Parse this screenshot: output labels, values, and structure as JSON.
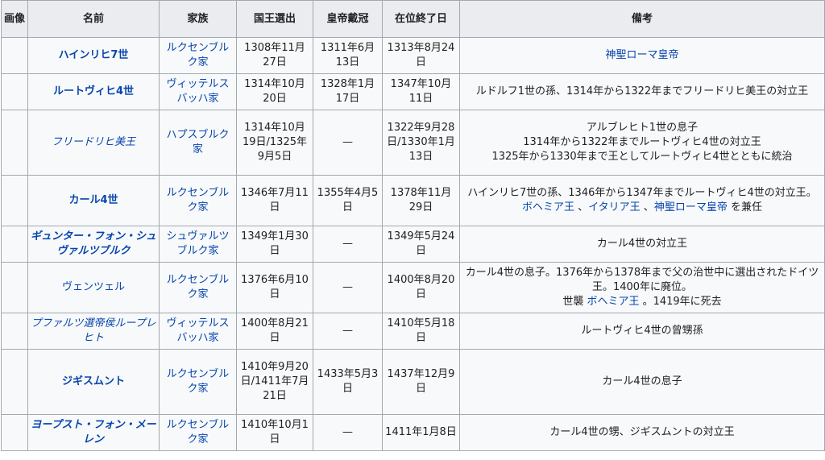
{
  "headers": {
    "image": "画像",
    "name": "名前",
    "family": "家族",
    "elected": "国王選出",
    "crowned": "皇帝戴冠",
    "end": "在位終了日",
    "remarks": "備考"
  },
  "rows": [
    {
      "name": "ハインリヒ7世",
      "family": "ルクセンブルク家",
      "elected": "1308年11月27日",
      "crowned": "1311年6月13日",
      "end": "1313年8月24日",
      "remarks": {
        "l1": "",
        "link1": "神聖ローマ皇帝",
        "t1": ""
      }
    },
    {
      "name": "ルートヴィヒ4世",
      "family": "ヴィッテルスバッハ家",
      "elected": "1314年10月20日",
      "crowned": "1328年1月17日",
      "end": "1347年10月11日",
      "remarks": {
        "l1": "ルドルフ1世の孫、1314年から1322年までフリードリヒ美王の対立王"
      }
    },
    {
      "name": "フリードリヒ美王",
      "family": "ハプスブルク家",
      "elected": "1314年10月19日/1325年9月5日",
      "crowned": "—",
      "end": "1322年9月28日/1330年1月13日",
      "remarks": {
        "l1": "アルブレヒト1世の息子",
        "l2": "1314年から1322年までルートヴィヒ4世の対立王",
        "l3": "1325年から1330年まで王としてルートヴィヒ4世とともに統治"
      }
    },
    {
      "name": "カール4世",
      "family": "ルクセンブルク家",
      "elected": "1346年7月11日",
      "crowned": "1355年4月5日",
      "end": "1378年11月29日",
      "remarks": {
        "l1": "ハインリヒ7世の孫、1346年から1347年までルートヴィヒ4世の対立王。",
        "link1": "ボヘミア王",
        "sep1": " 、",
        "link2": "イタリア王",
        "sep2": " 、",
        "link3": "神聖ローマ皇帝",
        "t1": " を兼任"
      }
    },
    {
      "name": "ギュンター・フォン・シュヴァルツブルク",
      "family": "シュヴァルツブルク家",
      "elected": "1349年1月30日",
      "crowned": "—",
      "end": "1349年5月24日",
      "remarks": {
        "l1": "カール4世の対立王"
      }
    },
    {
      "name": "ヴェンツェル",
      "family": "ルクセンブルク家",
      "elected": "1376年6月10日",
      "crowned": "—",
      "end": "1400年8月20日",
      "remarks": {
        "l1": "カール4世の息子。1376年から1378年まで父の治世中に選出されたドイツ王。1400年に廃位。",
        "t0": "世襲 ",
        "link1": "ボヘミア王",
        "t1": " 。1419年に死去"
      }
    },
    {
      "name": "プファルツ選帝侯ループレヒト",
      "family": "ヴィッテルスバッハ家",
      "elected": "1400年8月21日",
      "crowned": "—",
      "end": "1410年5月18日",
      "remarks": {
        "l1": "ルートヴィヒ4世の曾甥孫"
      }
    },
    {
      "name": "ジギスムント",
      "family": "ルクセンブルク家",
      "elected": "1410年9月20日/1411年7月21日",
      "crowned": "1433年5月3日",
      "end": "1437年12月9日",
      "remarks": {
        "l1": "カール4世の息子"
      }
    },
    {
      "name": "ヨープスト・フォン・メーレン",
      "family": "ルクセンブルク家",
      "elected": "1410年10月1日",
      "crowned": "—",
      "end": "1411年1月8日",
      "remarks": {
        "l1": "カール4世の甥、ジギスムントの対立王"
      }
    }
  ]
}
